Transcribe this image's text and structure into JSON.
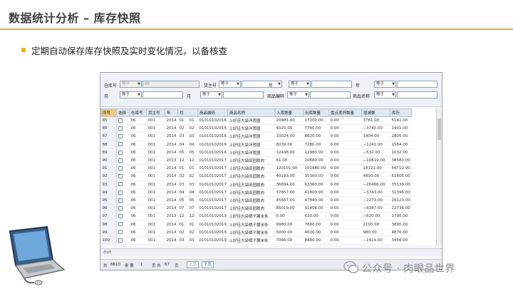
{
  "page": {
    "title": "数据统计分析 – 库存快照",
    "bullet": "定期自动保存库存快照及实时变化情况，以备核查"
  },
  "filter": {
    "row1": {
      "l1": "仓库号",
      "s1": "等于",
      "v1": "05",
      "l2": "货主号",
      "s2": "等于",
      "l3": "年",
      "s3": "等于",
      "l4": "年",
      "s4": "等于"
    },
    "row2": {
      "l1": "月",
      "s1": "等于",
      "l2": "月",
      "s2": "等于",
      "l3": "商品编码",
      "s3": "等于",
      "l4": "商品名称",
      "s4": "等于"
    }
  },
  "table": {
    "columns": [
      "序号",
      "选择",
      "仓库号",
      "货主号",
      "年",
      "月",
      "商品编码",
      "商品名称",
      "入库数量",
      "出库数量",
      "盘点差异数量",
      "增减数",
      "库存"
    ],
    "rows": [
      [
        "85",
        "",
        "06",
        "001",
        "2014",
        "01",
        "01",
        "01010102016",
        "上好佳大袋洋葱圈",
        "20981.00",
        "17200.00",
        "0.00",
        "3781.00",
        "5141.00"
      ],
      [
        "86",
        "",
        "06",
        "001",
        "2014",
        "02",
        "02",
        "01010102016",
        "上好佳大袋洋葱圈",
        "4020.00",
        "7760.00",
        "0.00",
        "−3740.00",
        "1401.00"
      ],
      [
        "87",
        "",
        "06",
        "001",
        "2014",
        "03",
        "03",
        "01010102016",
        "上好佳大袋洋葱圈",
        "10024.00",
        "8620.00",
        "0.00",
        "1404.00",
        "2805.00"
      ],
      [
        "88",
        "",
        "06",
        "001",
        "2014",
        "04",
        "04",
        "01010102016",
        "上好佳大袋洋葱圈",
        "6039.00",
        "7280.00",
        "0.00",
        "−1241.00",
        "1564.00"
      ],
      [
        "89",
        "",
        "06",
        "001",
        "2014",
        "05",
        "05",
        "01010102016",
        "上好佳大袋洋葱圈",
        "12448.00",
        "12980.00",
        "0.00",
        "−532.00",
        "1032.00"
      ],
      [
        "90",
        "",
        "06",
        "001",
        "2013",
        "12",
        "12",
        "01010102017",
        "上好佳大袋田园脆肉",
        "61.00",
        "10880.00",
        "0.00",
        "−10819.00",
        "38580.00"
      ],
      [
        "91",
        "",
        "06",
        "001",
        "2014",
        "01",
        "01",
        "01010102017",
        "上好佳大袋田园脆肉",
        "120101.00",
        "101980.00",
        "0.00",
        "18121.00",
        "56712.00"
      ],
      [
        "92",
        "",
        "06",
        "001",
        "2014",
        "02",
        "02",
        "01010102017",
        "上好佳大袋田园脆肉",
        "40193.00",
        "35300.00",
        "0.00",
        "4893.00",
        "61605.00"
      ],
      [
        "93",
        "",
        "06",
        "001",
        "2014",
        "03",
        "03",
        "01010102017",
        "上好佳大袋田园脆肉",
        "36894.00",
        "63360.00",
        "0.00",
        "−26466.00",
        "35139.00"
      ],
      [
        "94",
        "",
        "06",
        "001",
        "2014",
        "04",
        "04",
        "01010102017",
        "上好佳大袋田园脆肉",
        "37857.00",
        "41600.00",
        "0.00",
        "−3743.00",
        "31396.00"
      ],
      [
        "95",
        "",
        "06",
        "001",
        "2014",
        "05",
        "05",
        "01010102017",
        "上好佳大袋田园脆肉",
        "45567.00",
        "47840.00",
        "0.00",
        "−2273.00",
        "29123.00"
      ],
      [
        "96",
        "",
        "06",
        "001",
        "2014",
        "07",
        "07",
        "01010102017",
        "上好佳大袋田园脆肉",
        "85019.00",
        "91406.00",
        "0.00",
        "−6387.00",
        "22736.00"
      ],
      [
        "97",
        "",
        "06",
        "001",
        "2013",
        "12",
        "12",
        "01010102019",
        "上好佳大袋栖子薯米条",
        "0.00",
        "620.00",
        "0.00",
        "−620.00",
        "1790.00"
      ],
      [
        "98",
        "",
        "06",
        "001",
        "2014",
        "01",
        "01",
        "01010102019",
        "上好佳大袋栖子薯米条",
        "9980.00",
        "7880.00",
        "0.00",
        "2100.00",
        "3890.00"
      ],
      [
        "99",
        "",
        "06",
        "001",
        "2014",
        "02",
        "02",
        "01010102019",
        "上好佳大袋栖子薯米条",
        "5000.00",
        "4020.00",
        "0.00",
        "980.00",
        "4870.00"
      ],
      [
        "100",
        "",
        "06",
        "001",
        "2014",
        "03",
        "03",
        "01010102019",
        "上好佳大袋栖子薯米条",
        "7066.00",
        "8480.00",
        "0.00",
        "−1414.00",
        "3456.00"
      ]
    ]
  },
  "subtotal": {
    "label": "小计"
  },
  "pager": {
    "total_label": "共",
    "total": "6610",
    "unit": "条 第",
    "page": "1",
    "pages_label": "页 共",
    "pages": "67",
    "pages_unit": "页",
    "prev": "上页",
    "next": "下页"
  },
  "watermark": {
    "text": "公众号 · 肉眼品世界"
  },
  "colors": {
    "accent_line": "#e8a44a",
    "bullet": "#f0b400",
    "sort_header": "#f3c878"
  }
}
